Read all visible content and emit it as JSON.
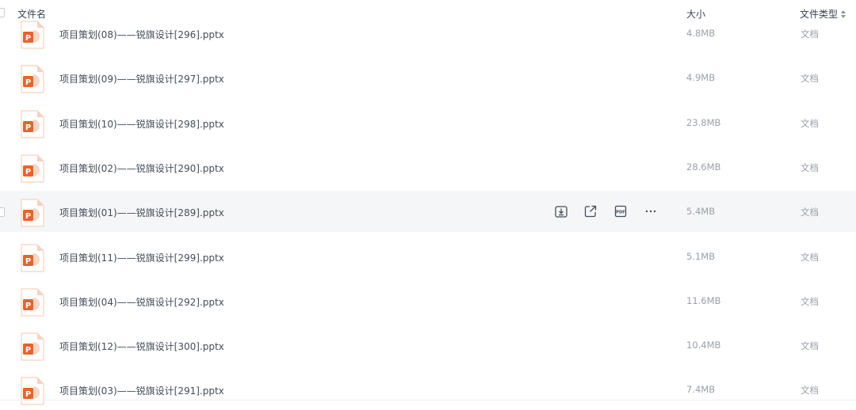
{
  "header": {
    "col_name": "文件名",
    "col_size": "大小",
    "col_type": "文件类型"
  },
  "colors": {
    "ppt_orange": "#e8632a",
    "ppt_light": "#f6d2c0",
    "hover_bg": "#f5f6f7",
    "muted_text": "#9aa0a8"
  },
  "actions": {
    "download": "download-icon",
    "share": "share-icon",
    "pdf": "pdf-icon",
    "more": "more-icon"
  },
  "files": [
    {
      "name": "项目策划(08)——锐旗设计[296].pptx",
      "size": "4.8MB",
      "type": "文档"
    },
    {
      "name": "项目策划(09)——锐旗设计[297].pptx",
      "size": "4.9MB",
      "type": "文档"
    },
    {
      "name": "项目策划(10)——锐旗设计[298].pptx",
      "size": "23.8MB",
      "type": "文档"
    },
    {
      "name": "项目策划(02)——锐旗设计[290].pptx",
      "size": "28.6MB",
      "type": "文档"
    },
    {
      "name": "项目策划(01)——锐旗设计[289].pptx",
      "size": "5.4MB",
      "type": "文档",
      "hovered": true
    },
    {
      "name": "项目策划(11)——锐旗设计[299].pptx",
      "size": "5.1MB",
      "type": "文档"
    },
    {
      "name": "项目策划(04)——锐旗设计[292].pptx",
      "size": "11.6MB",
      "type": "文档"
    },
    {
      "name": "项目策划(12)——锐旗设计[300].pptx",
      "size": "10.4MB",
      "type": "文档"
    },
    {
      "name": "项目策划(03)——锐旗设计[291].pptx",
      "size": "7.4MB",
      "type": "文档"
    }
  ]
}
